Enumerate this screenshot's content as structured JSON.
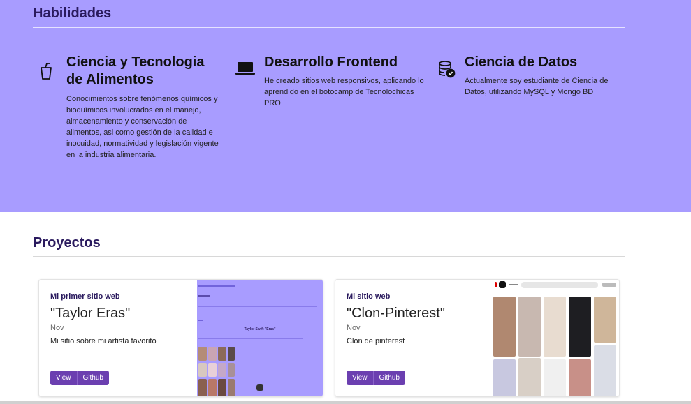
{
  "skills_section": {
    "title": "Habilidades",
    "items": [
      {
        "icon": "cup-icon",
        "title": "Ciencia y Tecnologia de Alimentos",
        "description": "Conocimientos sobre fenómenos químicos y bioquímicos involucrados en el manejo, almacenamiento y conservación de alimentos, asi como gestión de la calidad e inocuidad, normatividad y legislación vigente en la industria alimentaria."
      },
      {
        "icon": "laptop-icon",
        "title": "Desarrollo Frontend",
        "description": "He creado sitios web responsivos, aplicando lo aprendido en el botocamp de Tecnolochicas PRO"
      },
      {
        "icon": "database-check-icon",
        "title": "Ciencia de Datos",
        "description": "Actualmente soy estudiante de Ciencia de Datos, utilizando MySQL y Mongo BD"
      }
    ]
  },
  "projects_section": {
    "title": "Proyectos",
    "cards": [
      {
        "subtitle": "Mi primer sitio web",
        "title": "\"Taylor Eras\"",
        "date": "Nov",
        "text": "Mi sitio sobre mi artista favorito",
        "view_label": "View",
        "github_label": "Github",
        "thumb_heading": "Taylor Swift \"Eras\""
      },
      {
        "subtitle": "Mi sitio web",
        "title": "\"Clon-Pinterest\"",
        "date": "Nov",
        "text": "Clon de pinterest",
        "view_label": "View",
        "github_label": "Github"
      }
    ]
  },
  "colors": {
    "skills_bg": "#a89cff",
    "heading": "#2a1a5e",
    "button": "#6b3fb0"
  }
}
